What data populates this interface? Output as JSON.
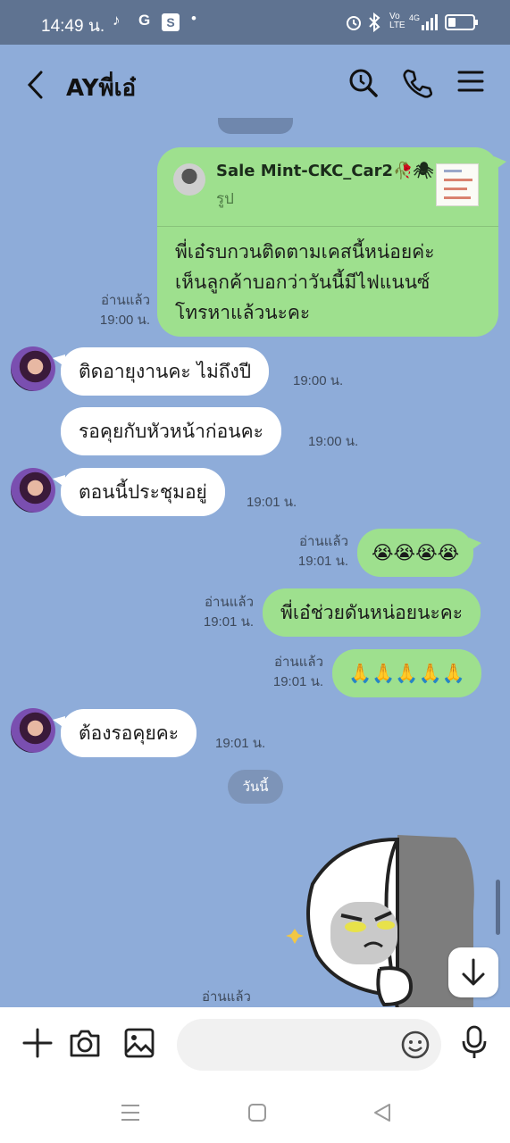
{
  "status_bar": {
    "time": "14:49 น.",
    "signal_label": "4G"
  },
  "header": {
    "title": "AYพี่เอ๋"
  },
  "reply_card": {
    "sender": "Sale Mint-CKC_Car2🥀🕷",
    "type": "รูป",
    "lines": [
      "พี่เอ๋รบกวนติดตามเคสนี้หน่อยค่ะ",
      "เห็นลูกค้าบอกว่าวันนี้มีไฟแนนซ์",
      "โทรหาแล้วนะคะ"
    ],
    "read": "อ่านแล้ว",
    "time": "19:00 น."
  },
  "messages": [
    {
      "side": "left",
      "text": "ติดอายุงานคะ ไม่ถึงปี",
      "time": "19:00 น."
    },
    {
      "side": "left",
      "text": "รอคุยกับหัวหน้าก่อนคะ",
      "time": "19:00 น."
    },
    {
      "side": "left",
      "text": "ตอนนี้ประชุมอยู่",
      "time": "19:01 น."
    },
    {
      "side": "right",
      "text": "😭😭😭😭",
      "read": "อ่านแล้ว",
      "time": "19:01 น."
    },
    {
      "side": "right",
      "text": "พี่เอ๋ช่วยดันหน่อยนะคะ",
      "read": "อ่านแล้ว",
      "time": "19:01 น."
    },
    {
      "side": "right",
      "text": "🙏🙏🙏🙏🙏",
      "read": "อ่านแล้ว",
      "time": "19:01 น."
    },
    {
      "side": "left",
      "text": "ต้องรอคุยคะ",
      "time": "19:01 น."
    }
  ],
  "day_separator": "วันนี้",
  "last_read": "อ่านแล้ว",
  "input": {
    "placeholder": ""
  },
  "colors": {
    "chat_bg": "#8eacd9",
    "my_bubble": "#9ee08e",
    "their_bubble": "#ffffff",
    "status_bar": "#5f7391"
  },
  "icons": {
    "back": "chevron-left-icon",
    "search": "search-icon",
    "call": "phone-icon",
    "menu": "menu-icon",
    "add": "plus-icon",
    "camera": "camera-icon",
    "image": "image-icon",
    "emoji": "emoji-icon",
    "mic": "mic-icon",
    "scroll_down": "arrow-down-icon"
  }
}
